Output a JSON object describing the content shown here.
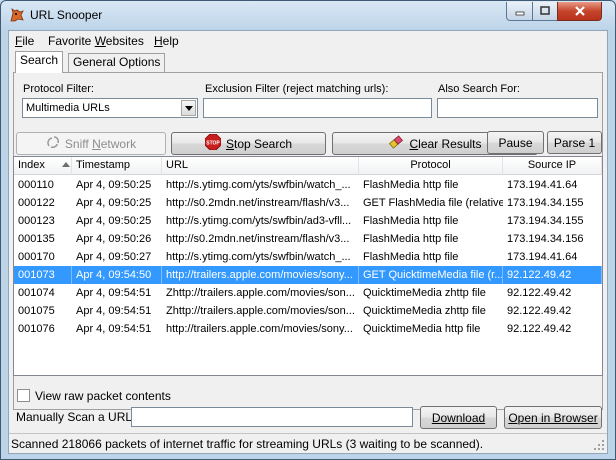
{
  "window": {
    "title": "URL Snooper",
    "icon": "app-mascot-icon"
  },
  "menu": [
    {
      "label": "File"
    },
    {
      "label": "Favorite Websites"
    },
    {
      "label": "Help"
    }
  ],
  "tabs": [
    {
      "label": "Search",
      "active": true
    },
    {
      "label": "General Options",
      "active": false
    }
  ],
  "filters": {
    "protocol_label": "Protocol Filter:",
    "protocol_value": "Multimedia URLs",
    "exclusion_label": "Exclusion Filter (reject matching urls):",
    "exclusion_value": "",
    "also_label": "Also Search For:",
    "also_value": ""
  },
  "toolbar": {
    "sniff_label": "Sniff Network",
    "stop_label": "Stop Search",
    "clear_label": "Clear Results",
    "pause_label": "Pause",
    "parse_label": "Parse 1"
  },
  "table": {
    "columns": [
      "Index",
      "Timestamp",
      "URL",
      "Protocol",
      "Source IP"
    ],
    "rows": [
      {
        "index": "000110",
        "timestamp": "Apr 4, 09:50:25",
        "url": "http://s.ytimg.com/yts/swfbin/watch_...",
        "protocol": "FlashMedia http file",
        "source_ip": "173.194.41.64"
      },
      {
        "index": "000122",
        "timestamp": "Apr 4, 09:50:25",
        "url": "http://s0.2mdn.net/instream/flash/v3...",
        "protocol": "GET FlashMedia file (relative)",
        "source_ip": "173.194.34.155"
      },
      {
        "index": "000123",
        "timestamp": "Apr 4, 09:50:25",
        "url": "http://s.ytimg.com/yts/swfbin/ad3-vfll...",
        "protocol": "FlashMedia http file",
        "source_ip": "173.194.34.155"
      },
      {
        "index": "000135",
        "timestamp": "Apr 4, 09:50:26",
        "url": "http://s0.2mdn.net/instream/flash/v3...",
        "protocol": "FlashMedia http file",
        "source_ip": "173.194.34.156"
      },
      {
        "index": "000170",
        "timestamp": "Apr 4, 09:50:27",
        "url": "http://s.ytimg.com/yts/swfbin/watch_...",
        "protocol": "FlashMedia http file",
        "source_ip": "173.194.41.64"
      },
      {
        "index": "001073",
        "timestamp": "Apr 4, 09:54:50",
        "url": "http://trailers.apple.com/movies/sony...",
        "protocol": "GET QuicktimeMedia file (r...",
        "source_ip": "92.122.49.42",
        "selected": true
      },
      {
        "index": "001074",
        "timestamp": "Apr 4, 09:54:51",
        "url": "Zhttp://trailers.apple.com/movies/son...",
        "protocol": "QuicktimeMedia zhttp file",
        "source_ip": "92.122.49.42"
      },
      {
        "index": "001075",
        "timestamp": "Apr 4, 09:54:51",
        "url": "Zhttp://trailers.apple.com/movies/son...",
        "protocol": "QuicktimeMedia zhttp file",
        "source_ip": "92.122.49.42"
      },
      {
        "index": "001076",
        "timestamp": "Apr 4, 09:54:51",
        "url": "http://trailers.apple.com/movies/sony...",
        "protocol": "QuicktimeMedia http file",
        "source_ip": "92.122.49.42"
      }
    ]
  },
  "bottom": {
    "raw_label": "View raw packet contents",
    "raw_checked": false,
    "scan_label": "Manually Scan a URL:",
    "scan_value": "",
    "download_label": "Download",
    "browser_label": "Open in Browser"
  },
  "status": {
    "text": "Scanned 218066 packets of internet traffic for streaming URLs (3 waiting to be scanned)."
  },
  "colors": {
    "selection": "#3399ff",
    "titlebar": "#bcd3e8",
    "close_button": "#c5462c"
  }
}
